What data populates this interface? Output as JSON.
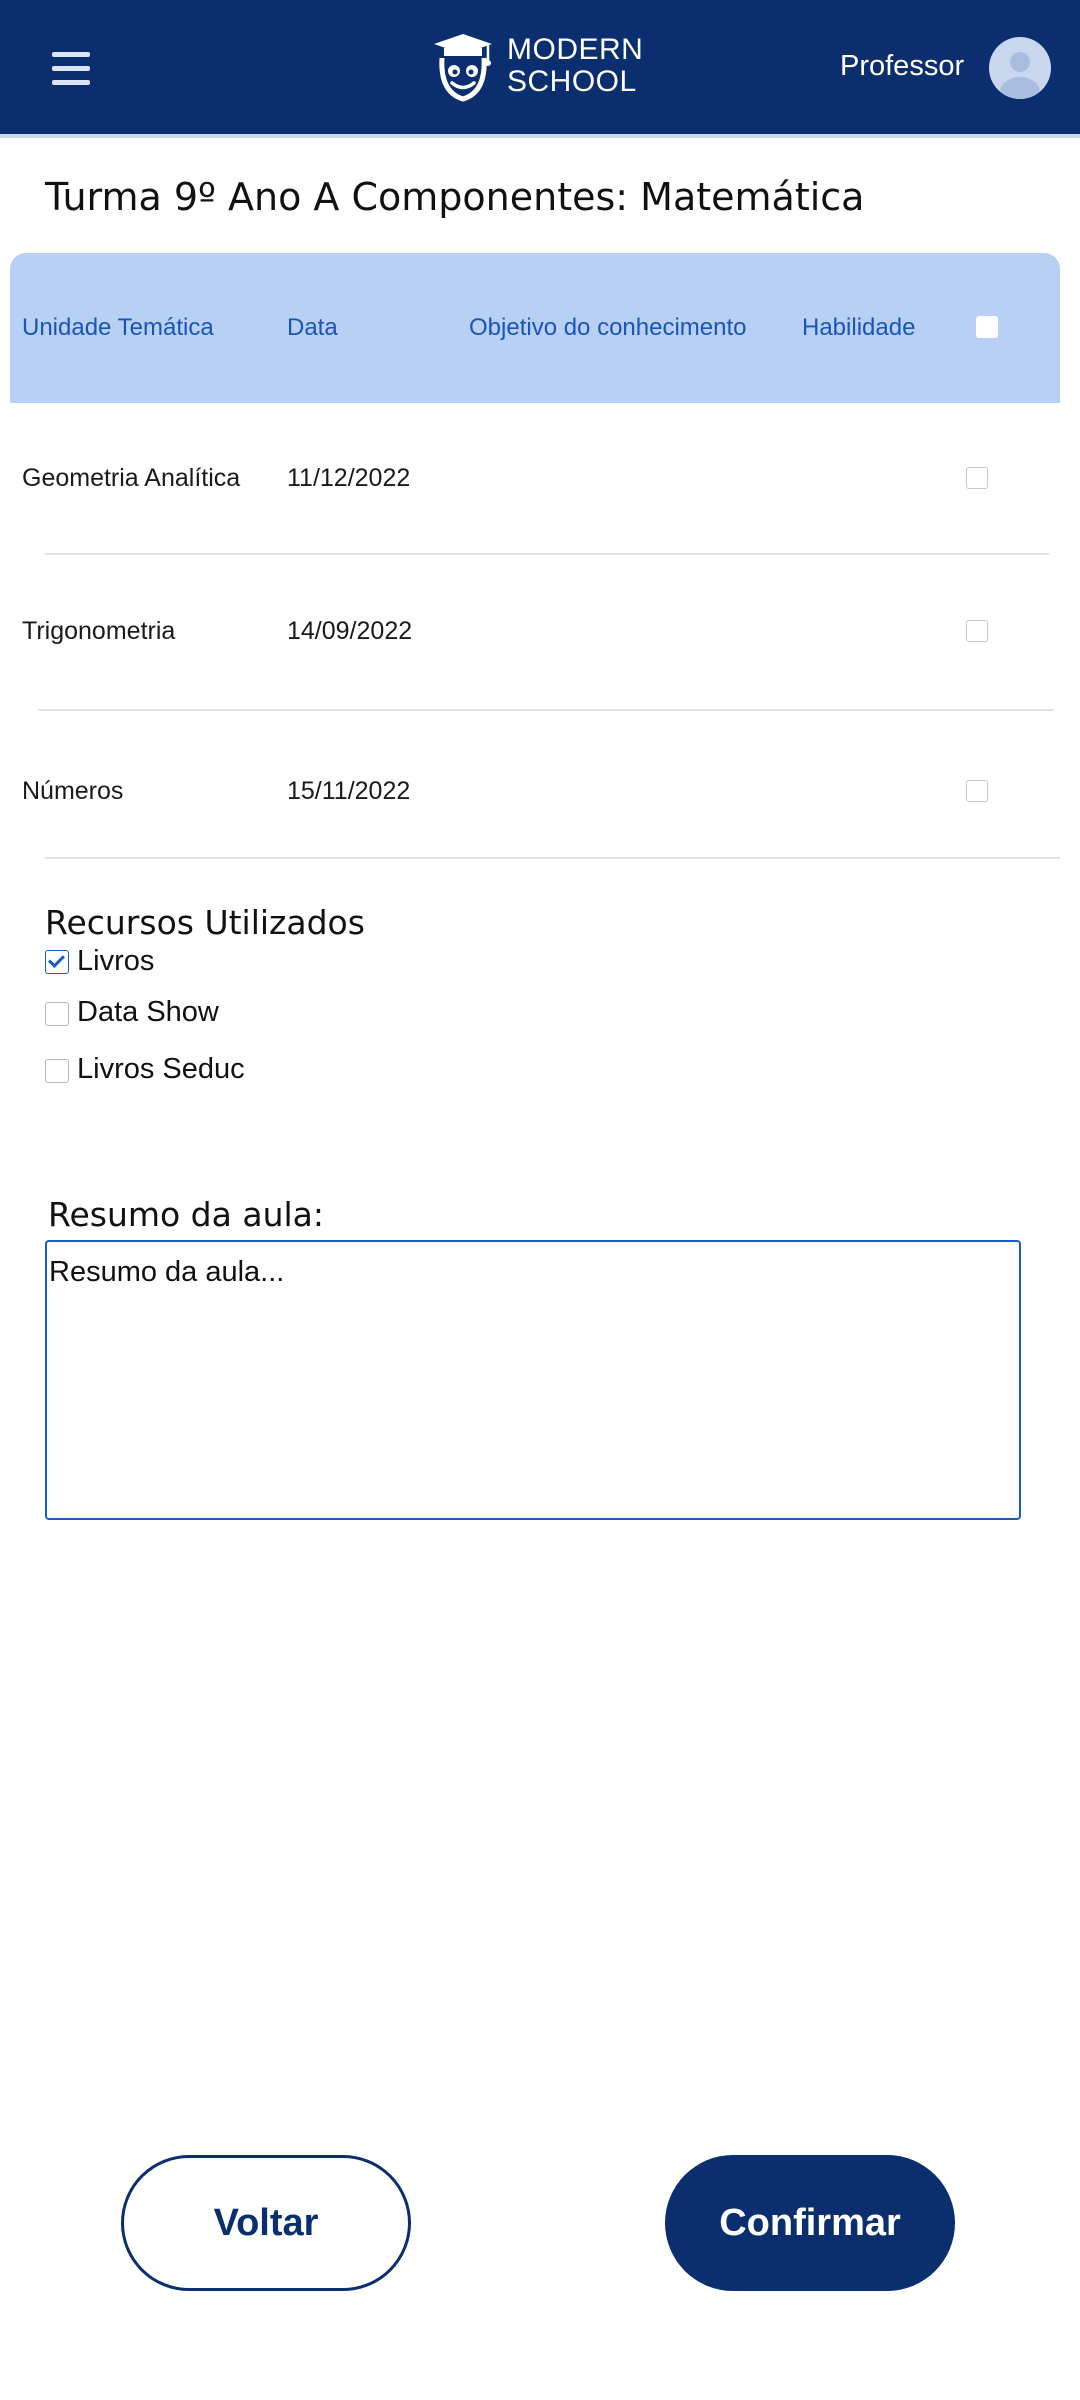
{
  "header": {
    "logo_line1": "MODERN",
    "logo_line2": "SCHOOL",
    "profile_label": "Professor"
  },
  "page": {
    "title": "Turma 9º Ano A Componentes: Matemática"
  },
  "table": {
    "headers": {
      "unidade": "Unidade Temática",
      "data": "Data",
      "objetivo": "Objetivo do conhecimento",
      "habilidade": "Habilidade"
    },
    "rows": [
      {
        "unidade": "Geometria Analítica",
        "data": "11/12/2022",
        "objetivo": "",
        "habilidade": "",
        "checked": false
      },
      {
        "unidade": "Trigonometria",
        "data": "14/09/2022",
        "objetivo": "",
        "habilidade": "",
        "checked": false
      },
      {
        "unidade": "Números",
        "data": "15/11/2022",
        "objetivo": "",
        "habilidade": "",
        "checked": false
      }
    ]
  },
  "resources": {
    "title": "Recursos Utilizados",
    "options": [
      {
        "label": "Livros",
        "checked": true
      },
      {
        "label": "Data Show",
        "checked": false
      },
      {
        "label": "Livros Seduc",
        "checked": false
      }
    ]
  },
  "summary": {
    "label": "Resumo da aula:",
    "placeholder": "Resumo da aula...",
    "value": ""
  },
  "buttons": {
    "back_label": "Voltar",
    "confirm_label": "Confirmar"
  },
  "colors": {
    "primary": "#0b2f6e",
    "table_header_bg": "#b7d0f4",
    "table_header_text": "#1a55b8",
    "accent": "#1a5bc4"
  }
}
